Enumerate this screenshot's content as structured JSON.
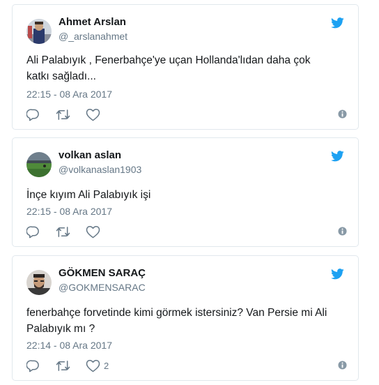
{
  "tweets": [
    {
      "name": "Ahmet Arslan",
      "handle": "@_arslanahmet",
      "text_line1": "Ali Palabıyık , Fenerbahçe'ye uçan Hollanda'lıdan daha çok",
      "text_line2": "katkı sağladı...",
      "time": "22:15 - 08 Ara 2017",
      "likes": ""
    },
    {
      "name": "volkan aslan",
      "handle": "@volkanaslan1903",
      "text_line1": "İnçe kıyım Ali Palabıyık işi",
      "text_line2": "",
      "time": "22:15 - 08 Ara 2017",
      "likes": ""
    },
    {
      "name": "GÖKMEN SARAÇ",
      "handle": "@GOKMENSARAC",
      "text_line1": "fenerbahçe forvetinde kimi görmek istersiniz? Van Persie mi Ali",
      "text_line2": "Palabıyık mı ?",
      "time": "22:14 - 08 Ara 2017",
      "likes": "2"
    }
  ],
  "icons": {
    "bird": "twitter-bird-icon",
    "reply": "reply-icon",
    "retweet": "retweet-icon",
    "like": "heart-icon",
    "info": "info-icon"
  },
  "colors": {
    "brand": "#1da1f2",
    "text": "#14171a",
    "secondary": "#657786",
    "border": "#e1e8ed"
  }
}
